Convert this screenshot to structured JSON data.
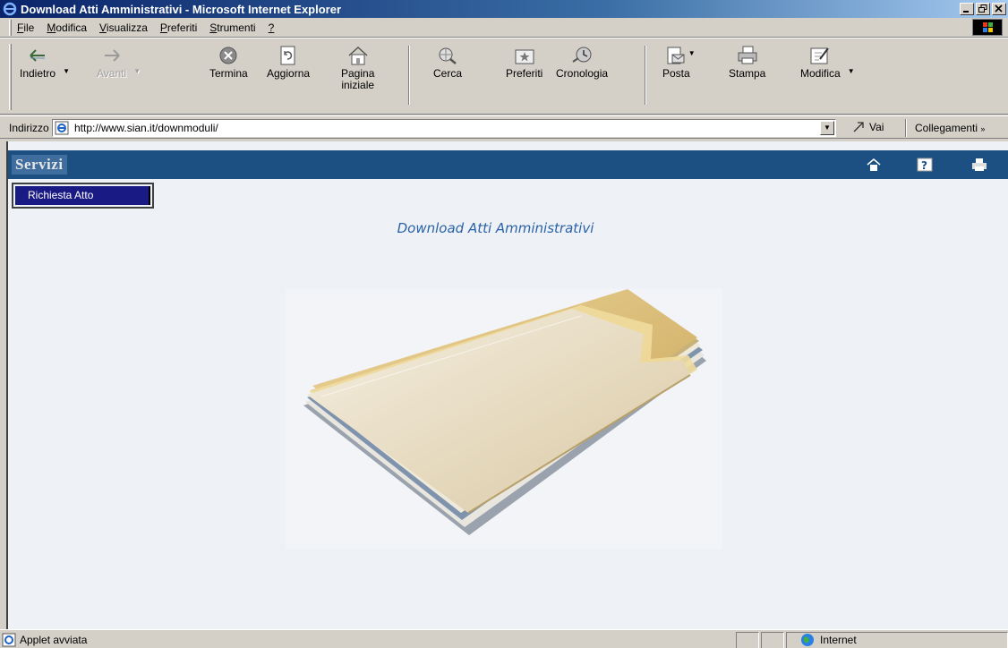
{
  "window": {
    "title": "Download Atti Amministrativi - Microsoft Internet Explorer"
  },
  "menubar": {
    "items": [
      {
        "first": "F",
        "rest": "ile"
      },
      {
        "first": "M",
        "rest": "odifica"
      },
      {
        "first": "V",
        "rest": "isualizza"
      },
      {
        "first": "P",
        "rest": "referiti"
      },
      {
        "first": "S",
        "rest": "trumenti"
      },
      {
        "first": "?",
        "rest": ""
      }
    ]
  },
  "toolbar": {
    "back": "Indietro",
    "forward": "Avanti",
    "stop": "Termina",
    "refresh": "Aggiorna",
    "home_line1": "Pagina",
    "home_line2": "iniziale",
    "search": "Cerca",
    "favorites": "Preferiti",
    "history": "Cronologia",
    "mail": "Posta",
    "print": "Stampa",
    "edit": "Modifica"
  },
  "address": {
    "label": "Indirizzo",
    "url": "http://www.sian.it/downmoduli/",
    "go": "Vai",
    "links": "Collegamenti"
  },
  "site": {
    "brand": "Servizi",
    "menu_button": "Richiesta Atto",
    "page_title": "Download Atti Amministrativi"
  },
  "status": {
    "message": "Applet avviata",
    "zone": "Internet"
  },
  "colors": {
    "header_bg": "#1c4f82",
    "menu_button_bg": "#1a1a84",
    "title_color": "#2a62a6",
    "content_bg": "#eef1f6"
  }
}
